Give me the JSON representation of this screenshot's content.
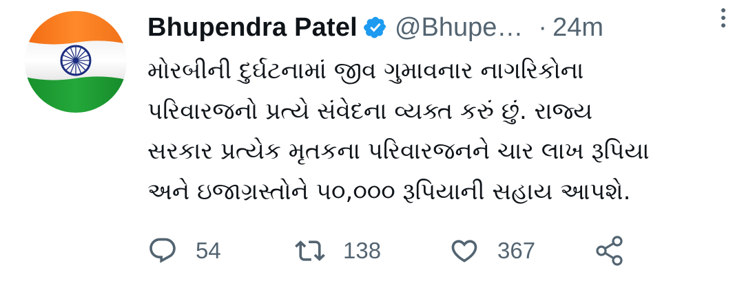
{
  "author": {
    "name": "Bhupendra Patel",
    "handle": "@Bhupe…",
    "separator": "·",
    "time": "24m"
  },
  "icons": {
    "avatar": "indian-flag",
    "verified": "verified-badge-icon",
    "more": "more-vertical-icon",
    "reply": "reply-icon",
    "retweet": "retweet-icon",
    "like": "heart-icon",
    "share": "share-icon"
  },
  "colors": {
    "verified_blue": "#1d9bf0",
    "secondary_text": "#536471",
    "primary_text": "#0f1419",
    "saffron": "#ff7a1a",
    "green": "#1f9e34",
    "chakra_navy": "#1c2d80"
  },
  "tweet": {
    "lines": [
      "મોરબીની દુર્ઘટનામાં જીવ ગુમાવનાર નાગરિકોના",
      "પરિવારજનો પ્રત્યે સંવેદના વ્યક્ત કરું છું. રાજ્ય",
      "સરકાર પ્રત્યેક મૃતકના પરિવારજનને ચાર લાખ રૂપિયા",
      "અને ઇજાગ્રસ્તોને ૫૦,૦૦૦ રૂપિયાની સહાય આપશે."
    ]
  },
  "actions": {
    "replies": "54",
    "retweets": "138",
    "likes": "367"
  }
}
